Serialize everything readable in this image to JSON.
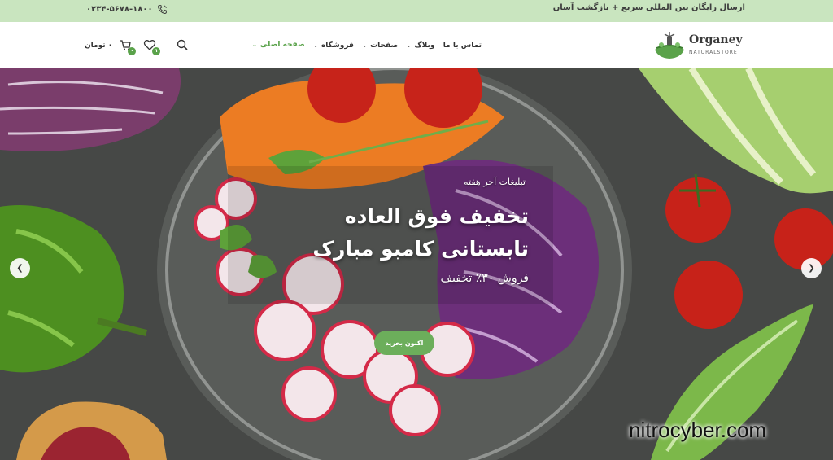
{
  "topbar": {
    "promo": "ارسال رایگان بین المللی سریع + بازگشت آسان",
    "phone": "۰۲۳۴-۵۶۷۸-۱۸۰۰",
    "phone_icon": "phone-icon"
  },
  "header": {
    "logo": {
      "name": "Organey",
      "tagline": "NATURALSTORE"
    },
    "nav": [
      {
        "label": "صفحه اصلی",
        "active": true
      },
      {
        "label": "فروشگاه"
      },
      {
        "label": "صفحات"
      },
      {
        "label": "وبلاگ"
      },
      {
        "label": "تماس با ما"
      }
    ],
    "actions": {
      "search_icon": "search-icon",
      "wishlist_icon": "heart-icon",
      "wishlist_count": "۱",
      "cart_icon": "cart-icon",
      "cart_count": "۰",
      "currency": "۰ تومان"
    }
  },
  "hero": {
    "subtitle": "تبلیغات آخر هفته",
    "title_line1": "تخفیف فوق العاده",
    "title_line2": "تابستانی کامبو مبارک",
    "offer": "فروش ۳۰٪ تخفیف",
    "cta_label": "اکنون بخرید",
    "prev_icon": "chevron-left-icon",
    "next_icon": "chevron-right-icon"
  },
  "watermark": "nitrocyber.com",
  "colors": {
    "accent": "#5aa24a",
    "topbar_bg": "#c9e5bf",
    "button": "#6cae5b"
  }
}
